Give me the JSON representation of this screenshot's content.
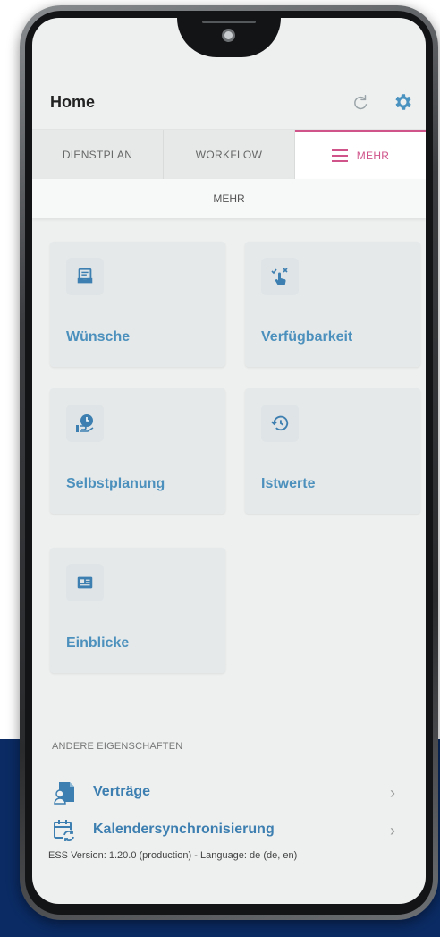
{
  "header": {
    "title": "Home"
  },
  "tabs": [
    {
      "label": "DIENSTPLAN",
      "active": false
    },
    {
      "label": "WORKFLOW",
      "active": false
    },
    {
      "label": "MEHR",
      "active": true
    }
  ],
  "subheader": {
    "label": "MEHR"
  },
  "cards": [
    {
      "label": "Wünsche",
      "icon": "inbox-tray-icon"
    },
    {
      "label": "Verfügbarkeit",
      "icon": "touch-check-cross-icon"
    },
    {
      "label": "Selbstplanung",
      "icon": "hand-clock-icon"
    },
    {
      "label": "Istwerte",
      "icon": "history-clock-icon"
    },
    {
      "label": "Einblicke",
      "icon": "id-card-icon"
    }
  ],
  "section": {
    "title": "ANDERE EIGENSCHAFTEN",
    "items": [
      {
        "label": "Verträge",
        "icon": "contract-document-icon"
      },
      {
        "label": "Kalendersynchronisierung",
        "icon": "calendar-sync-icon"
      }
    ]
  },
  "footer": {
    "version_text": "ESS Version: 1.20.0 (production) - Language: de (de, en)"
  },
  "colors": {
    "accent": "#d0548a",
    "link_blue": "#4c91bd",
    "background_band": "#0b2b64"
  }
}
